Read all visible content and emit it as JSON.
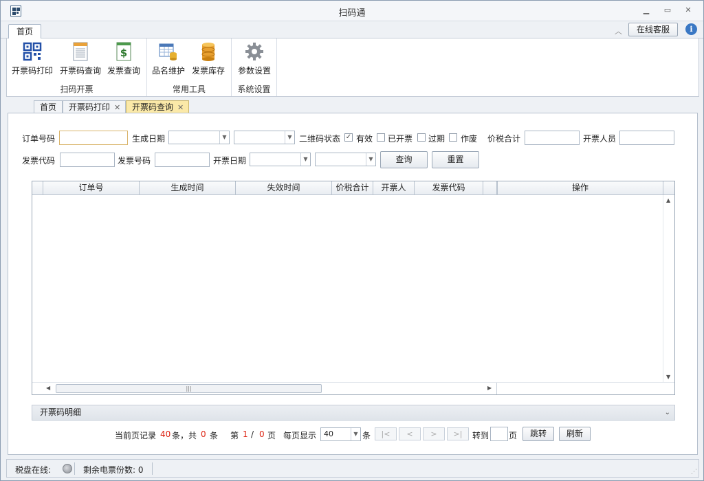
{
  "window": {
    "title": "扫码通"
  },
  "ribbon": {
    "tab": "首页",
    "online_service": "在线客服",
    "groups": [
      {
        "label": "扫码开票",
        "buttons": [
          "开票码打印",
          "开票码查询",
          "发票查询"
        ]
      },
      {
        "label": "常用工具",
        "buttons": [
          "品名维护",
          "发票库存"
        ]
      },
      {
        "label": "系统设置",
        "buttons": [
          "参数设置"
        ]
      }
    ]
  },
  "doc_tabs": [
    "首页",
    "开票码打印",
    "开票码查询"
  ],
  "form": {
    "order_no": "订单号码",
    "gen_date": "生成日期",
    "qr_status": "二维码状态",
    "valid": "有效",
    "issued": "已开票",
    "expired": "过期",
    "void": "作废",
    "total_tax": "价税合计",
    "issuer": "开票人员",
    "invoice_code": "发票代码",
    "invoice_no": "发票号码",
    "issue_date": "开票日期",
    "query": "查询",
    "reset": "重置"
  },
  "grid": {
    "columns": [
      "订单号",
      "生成时间",
      "失效时间",
      "价税合计",
      "开票人",
      "发票代码",
      "",
      "操作"
    ]
  },
  "detail": {
    "label": "开票码明细"
  },
  "pager": {
    "current_records_prefix": "当前页记录",
    "current_records": "40",
    "tiao_total": "条，共",
    "total": "0",
    "tiao": "条",
    "di": "第",
    "page": "1",
    "slash": "/",
    "pages": "0",
    "ye": "页",
    "per_page_label": "每页显示",
    "per_page": "40",
    "tiao2": "条",
    "goto": "转到",
    "ye2": "页",
    "jump": "跳转",
    "refresh": "刷新"
  },
  "status": {
    "disk_online": "税盘在线:",
    "remaining": "剩余电票份数: 0"
  }
}
